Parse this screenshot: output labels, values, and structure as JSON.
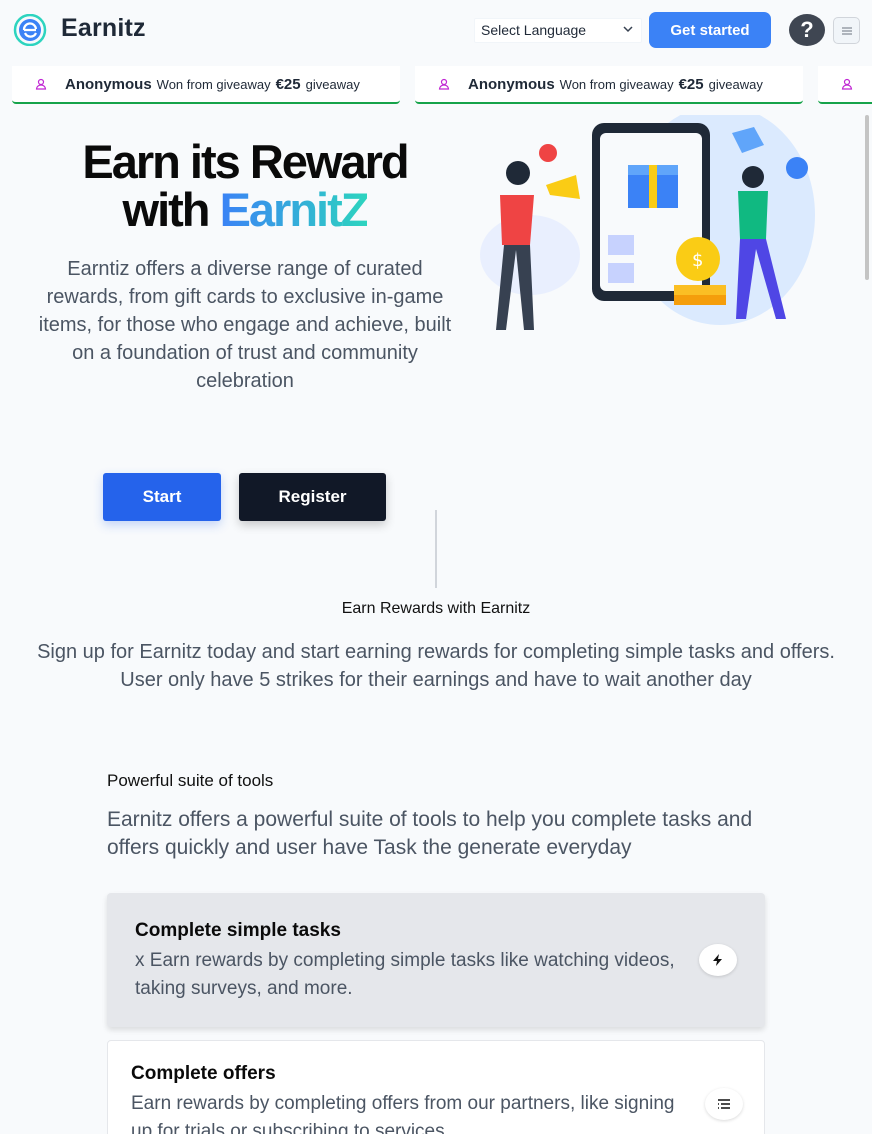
{
  "header": {
    "logo_text": "Earnitz",
    "language_select": "Select Language",
    "get_started": "Get started",
    "help": "?"
  },
  "ticker": [
    {
      "user": "Anonymous",
      "text": "Won from giveaway",
      "amount": "€25",
      "suffix": "giveaway"
    },
    {
      "user": "Anonymous",
      "text": "Won from giveaway",
      "amount": "€25",
      "suffix": "giveaway"
    }
  ],
  "hero": {
    "title_line1": "Earn its Reward",
    "title_with": "with",
    "title_brand": "EarnitZ",
    "description": "Earntiz offers a diverse range of curated rewards, from gift cards to exclusive in-game items, for those who engage and achieve, built on a foundation of trust and community celebration",
    "start": "Start",
    "register": "Register"
  },
  "earn_section": {
    "kicker": "Earn Rewards with Earnitz",
    "description": "Sign up for Earnitz today and start earning rewards for completing simple tasks and offers. User only have 5 strikes for their earnings and have to wait another day"
  },
  "tools_section": {
    "kicker": "Powerful suite of tools",
    "description": "Earnitz offers a powerful suite of tools to help you complete tasks and offers quickly and user have Task the generate everyday"
  },
  "features": [
    {
      "title": "Complete simple tasks",
      "text": "x Earn rewards by completing simple tasks like watching videos, taking surveys, and more.",
      "icon": "lightning-icon"
    },
    {
      "title": "Complete offers",
      "text": "Earn rewards by completing offers from our partners, like signing up for trials or subscribing to services.",
      "icon": "list-icon"
    }
  ],
  "colors": {
    "primary": "#3b82f6",
    "dark": "#111827",
    "ticker_border": "#16a34a"
  }
}
